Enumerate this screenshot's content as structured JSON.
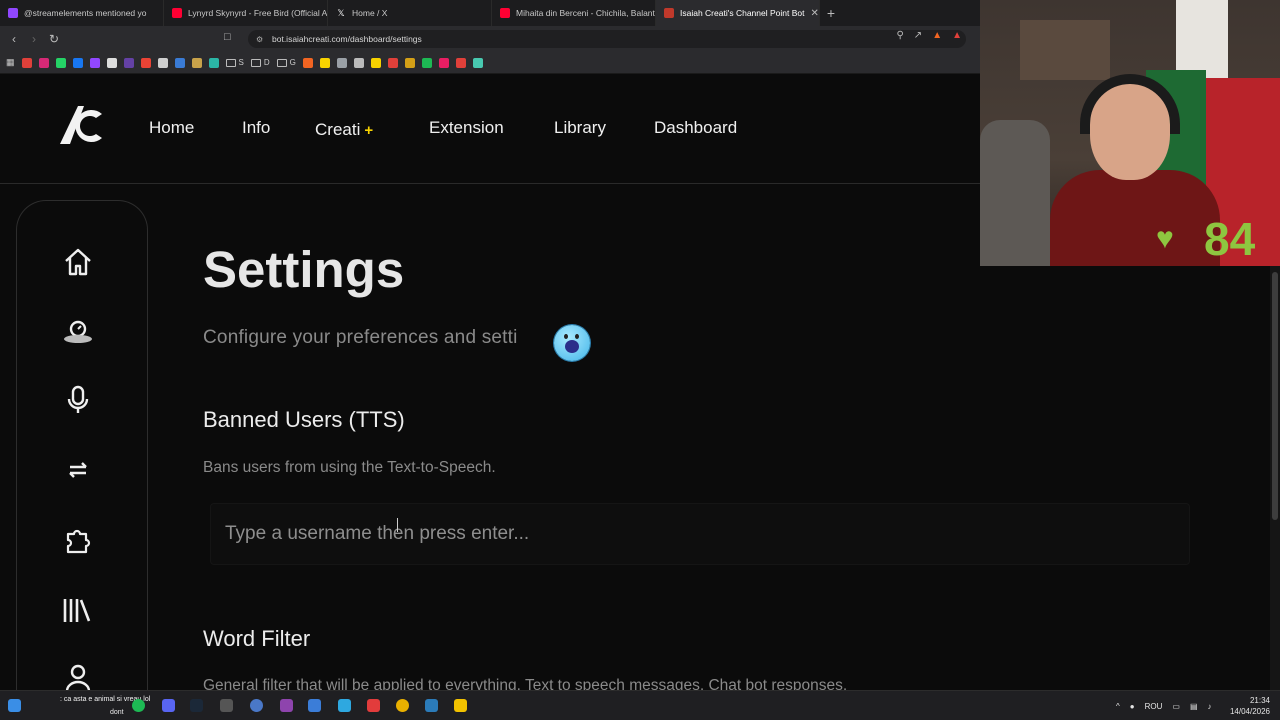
{
  "browser": {
    "tabs": [
      {
        "label": "@streamelements mentioned yo",
        "color": "#9147ff",
        "active": false
      },
      {
        "label": "Lynyrd Skynyrd - Free Bird (Official A",
        "color": "#ff0033",
        "active": false
      },
      {
        "label": "Home / X",
        "color": "#ffffff",
        "active": false
      },
      {
        "label": "Mihaita din Berceni - Chichila, Balant",
        "color": "#ff0033",
        "active": false
      },
      {
        "label": "Isaiah Creati's Channel Point Bot",
        "color": "#c0392b",
        "active": true
      }
    ],
    "close_tab": "✕",
    "new_tab": "+",
    "url": "bot.isaiahcreati.com/dashboard/settings",
    "bookmark_folders": [
      "S",
      "D",
      "G"
    ]
  },
  "site": {
    "nav": [
      "Home",
      "Info",
      "Creati",
      "Extension",
      "Library",
      "Dashboard"
    ],
    "creati_plus": "+",
    "accent": "#f7d200"
  },
  "sidebar": {
    "icons": [
      "home-icon",
      "dashboard-icon",
      "microphone-icon",
      "swap-arrows-icon",
      "puzzle-icon",
      "library-icon",
      "user-icon"
    ]
  },
  "settings": {
    "title": "Settings",
    "subtitle": "Configure your preferences and setti",
    "banned": {
      "heading": "Banned Users (TTS)",
      "description": "Bans users from using the Text-to-Speech.",
      "placeholder": "Type a username then press enter..."
    },
    "word_filter": {
      "heading": "Word Filter",
      "description": "General filter that will be applied to everything. Text to speech messages, Chat bot responses,"
    }
  },
  "overlay": {
    "heart_rate": "84",
    "heart_color": "#8ec640"
  },
  "taskbar": {
    "chat_line": ": ca asta e animal si vreau lol",
    "chat_line2": "dont",
    "language": "ROU",
    "time": "21:34",
    "date": "14/04/2026"
  }
}
